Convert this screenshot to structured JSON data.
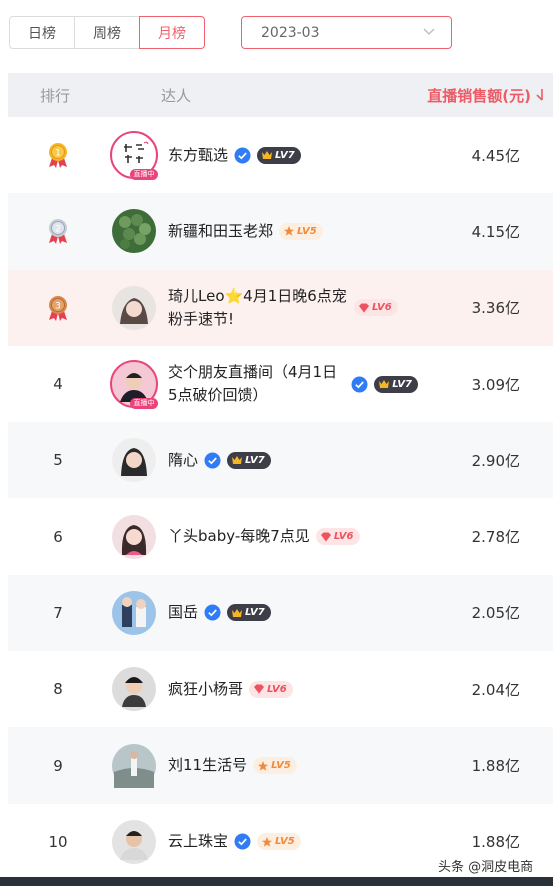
{
  "tabs": [
    {
      "label": "日榜",
      "active": false
    },
    {
      "label": "周榜",
      "active": false
    },
    {
      "label": "月榜",
      "active": true
    }
  ],
  "date_select": {
    "value": "2023-03"
  },
  "table_header": {
    "rank": "排行",
    "name": "达人",
    "sales": "直播销售额(元)"
  },
  "colors": {
    "accent": "#f0616d",
    "header_bg": "#eef0f3",
    "gold": "#f3a51a",
    "verified": "#2f7cf6"
  },
  "rows": [
    {
      "rank": "1",
      "medal": "gold-medal-icon",
      "name": "东方甄选",
      "verified": true,
      "level": "LV7",
      "level_style": "dark",
      "sales": "4.45亿",
      "live": "直播中"
    },
    {
      "rank": "2",
      "medal": "silver-medal-icon",
      "name": "新疆和田玉老郑",
      "verified": false,
      "level": "LV5",
      "level_style": "peach",
      "sales": "4.15亿"
    },
    {
      "rank": "3",
      "medal": "bronze-medal-icon",
      "name": "琦儿Leo⭐4月1日晚6点宠粉手速节!",
      "verified": false,
      "level": "LV6",
      "level_style": "pink",
      "sales": "3.36亿"
    },
    {
      "rank": "4",
      "name": "交个朋友直播间（4月1日5点破价回馈）",
      "verified": true,
      "level": "LV7",
      "level_style": "dark",
      "sales": "3.09亿",
      "live": "直播中"
    },
    {
      "rank": "5",
      "name": "隋心",
      "verified": true,
      "level": "LV7",
      "level_style": "dark",
      "sales": "2.90亿"
    },
    {
      "rank": "6",
      "name": "丫头baby-每晚7点见",
      "verified": false,
      "level": "LV6",
      "level_style": "pink",
      "sales": "2.78亿"
    },
    {
      "rank": "7",
      "name": "国岳",
      "verified": true,
      "level": "LV7",
      "level_style": "dark",
      "sales": "2.05亿"
    },
    {
      "rank": "8",
      "name": "疯狂小杨哥",
      "verified": false,
      "level": "LV6",
      "level_style": "pink",
      "sales": "2.04亿"
    },
    {
      "rank": "9",
      "name": "刘11生活号",
      "verified": false,
      "level": "LV5",
      "level_style": "peach",
      "sales": "1.88亿"
    },
    {
      "rank": "10",
      "name": "云上珠宝",
      "verified": true,
      "level": "LV5",
      "level_style": "peach",
      "sales": "1.88亿"
    }
  ],
  "watermark": "头条 @洞皮电商"
}
